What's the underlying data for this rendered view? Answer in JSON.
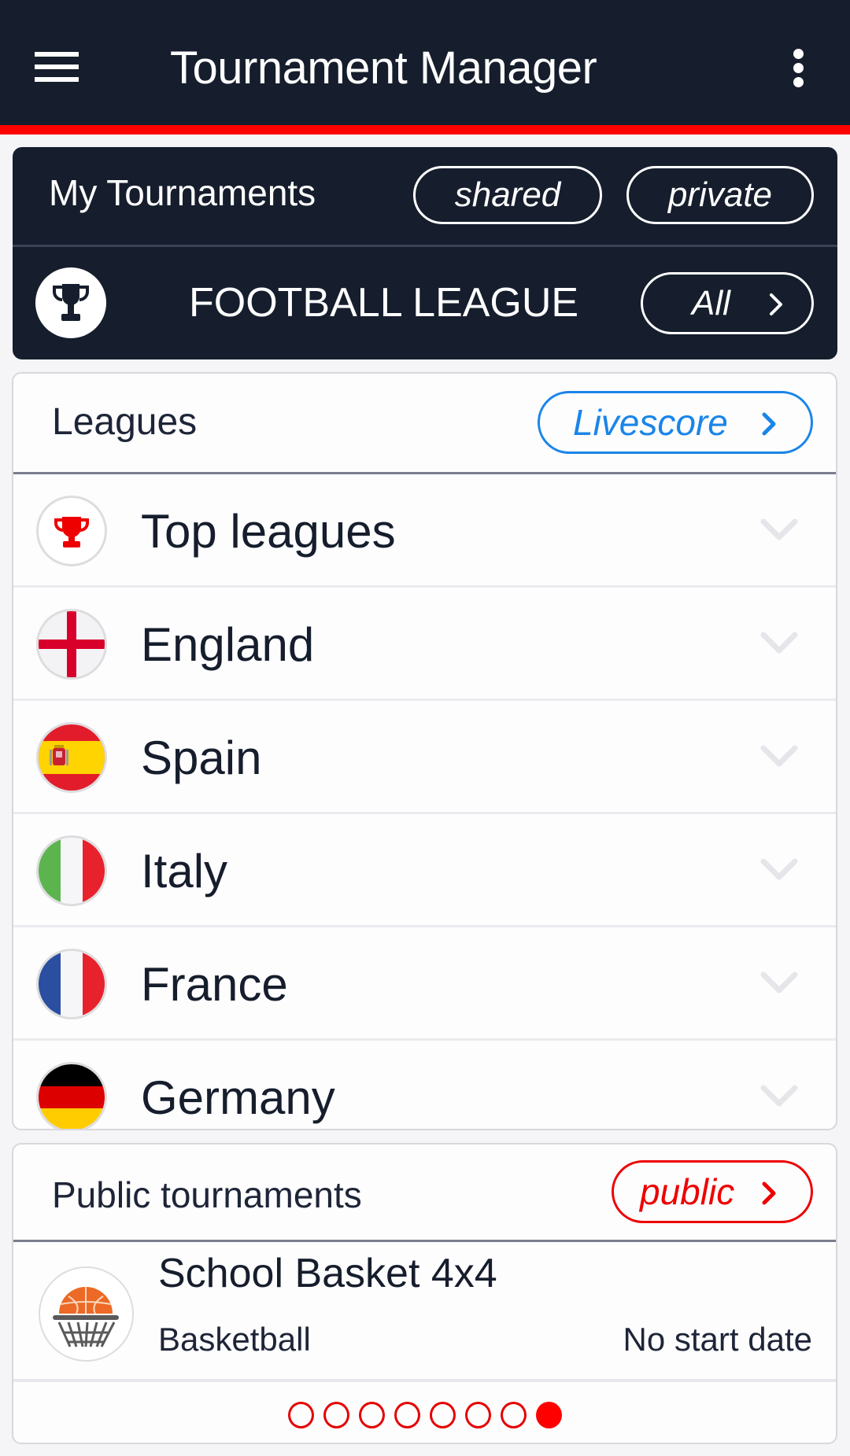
{
  "appbar": {
    "title": "Tournament Manager",
    "menu_icon": "hamburger-menu-icon",
    "overflow_icon": "more-vert-icon",
    "background": "#161e2d",
    "accent": "#ff0000"
  },
  "my_tournaments": {
    "title": "My Tournaments",
    "shared_label": "shared",
    "private_label": "private",
    "current_league": "FOOTBALL LEAGUE",
    "league_icon": "trophy-icon",
    "all_label": "All"
  },
  "leagues": {
    "title": "Leagues",
    "livescore_label": "Livescore",
    "livescore_color": "#1a85e8",
    "items": [
      {
        "label": "Top leagues",
        "icon": "trophy-icon"
      },
      {
        "label": "England",
        "icon": "flag-england"
      },
      {
        "label": "Spain",
        "icon": "flag-spain"
      },
      {
        "label": "Italy",
        "icon": "flag-italy"
      },
      {
        "label": "France",
        "icon": "flag-france"
      },
      {
        "label": "Germany",
        "icon": "flag-germany"
      }
    ]
  },
  "public_tournaments": {
    "title": "Public tournaments",
    "public_label": "public",
    "public_color": "#ee0000",
    "items": [
      {
        "name": "School Basket 4x4",
        "sport": "Basketball",
        "start_date": "No start date",
        "icon": "basketball-hoop-icon"
      }
    ],
    "pager": {
      "total_pages": 8,
      "current_page": 8
    }
  }
}
